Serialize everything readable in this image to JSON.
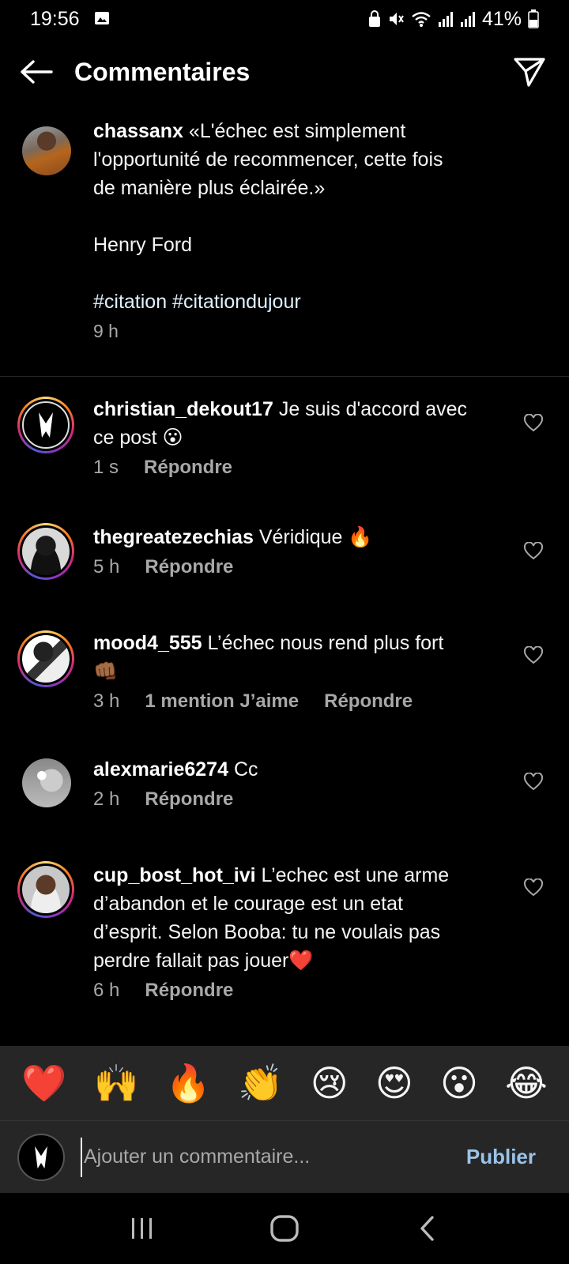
{
  "status_bar": {
    "time": "19:56",
    "battery": "41%"
  },
  "header": {
    "title": "Commentaires"
  },
  "caption": {
    "username": "chassanx",
    "lines": [
      "«L'échec est simplement",
      "l'opportunité de recommencer, cette fois",
      "de manière plus éclairée.»",
      "",
      "Henry Ford",
      "",
      "#citation #citationdujour"
    ],
    "time": "9 h"
  },
  "comments": [
    {
      "username": "christian_dekout17",
      "text": "Je suis d'accord avec",
      "text2": "ce post 😮",
      "time": "1 s",
      "reply": "Répondre"
    },
    {
      "username": "thegreatezechias",
      "text": "Véridique 🔥",
      "time": "5 h",
      "reply": "Répondre"
    },
    {
      "username": "mood4_555",
      "text": "L’échec nous rend plus fort",
      "text2": "👊🏾",
      "time": "3 h",
      "likes": "1 mention J’aime",
      "reply": "Répondre"
    },
    {
      "username": "alexmarie6274",
      "text": "Cc",
      "time": "2 h",
      "reply": "Répondre"
    },
    {
      "username": "cup_bost_hot_ivi",
      "text": "L’echec est une arme",
      "text2": "d’abandon et le courage est un etat",
      "text3": "d’esprit. Selon Booba: tu ne voulais pas",
      "text4": "perdre fallait pas jouer❤️",
      "time": "6 h",
      "reply": "Répondre"
    }
  ],
  "emoji_bar": [
    "❤️",
    "🙌",
    "🔥",
    "👏",
    "😢",
    "😍",
    "😮",
    "😂"
  ],
  "composer": {
    "placeholder": "Ajouter un commentaire...",
    "publish": "Publier"
  },
  "colors": {
    "background": "#000000",
    "panel": "#262626",
    "secondary_text": "#a8a8a8",
    "publish": "#9ac3ea"
  }
}
